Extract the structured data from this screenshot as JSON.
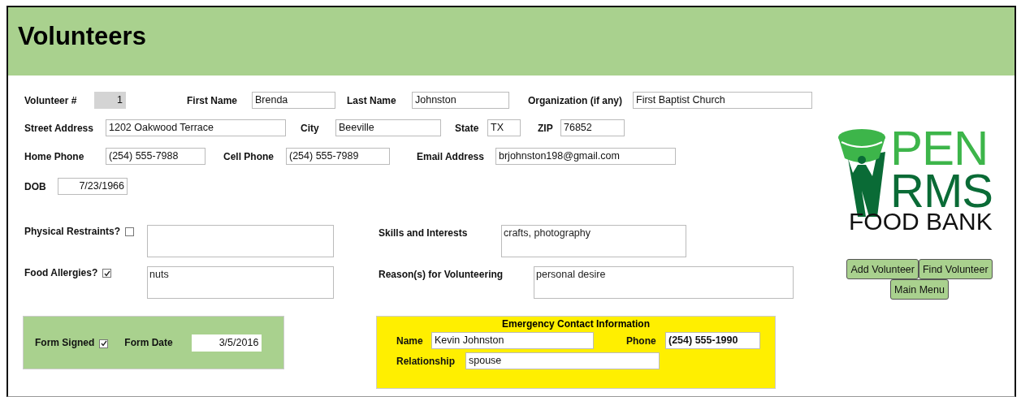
{
  "title": "Volunteers",
  "field_rows": [
    [
      {
        "label": "Volunteer #",
        "value": "1",
        "kind": "locked"
      },
      {
        "label": "First Name",
        "value": "Brenda",
        "kind": "text"
      },
      {
        "label": "Last Name",
        "value": "Johnston",
        "kind": "text"
      },
      {
        "label": "Organization (if any)",
        "value": "First Baptist Church",
        "kind": "text"
      }
    ],
    [
      {
        "label": "Street Address",
        "value": "1202 Oakwood Terrace",
        "kind": "text"
      },
      {
        "label": "City",
        "value": "Beeville",
        "kind": "text"
      },
      {
        "label": "State",
        "value": "TX",
        "kind": "text"
      },
      {
        "label": "ZIP",
        "value": "76852",
        "kind": "text"
      }
    ],
    [
      {
        "label": "Home Phone",
        "value": "(254) 555-7988",
        "kind": "text"
      },
      {
        "label": "Cell Phone",
        "value": "(254) 555-7989",
        "kind": "text"
      },
      {
        "label": "Email Address",
        "value": "brjohnston198@gmail.com",
        "kind": "text"
      }
    ],
    [
      {
        "label": "DOB",
        "value": "7/23/1966",
        "kind": "date"
      }
    ]
  ],
  "check_rows": [
    {
      "label": "Physical Restraints?",
      "checked": false,
      "other_label": "Skills and Interests",
      "other_value": "crafts, photography"
    },
    {
      "label": "Food Allergies?",
      "checked": true,
      "notes": "nuts",
      "other_label": "Reason(s)  for Volunteering",
      "other_value": "personal desire"
    }
  ],
  "signature": {
    "signed_label": "Form Signed",
    "signed": true,
    "date_label": "Form Date",
    "date": "3/5/2016"
  },
  "emergency": {
    "title": "Emergency Contact Information",
    "name_label": "Name",
    "name": "Kevin Johnston",
    "phone_label": "Phone",
    "phone": "(254) 555-1990",
    "relationship_label": "Relationship",
    "relationship": "spouse"
  },
  "logo": {
    "line_1": "PEN",
    "line_2": "RMS",
    "line_3": "FOOD BANK"
  },
  "buttons": [
    "Add Volunteer",
    "Find Volunteer",
    "Main Menu"
  ]
}
